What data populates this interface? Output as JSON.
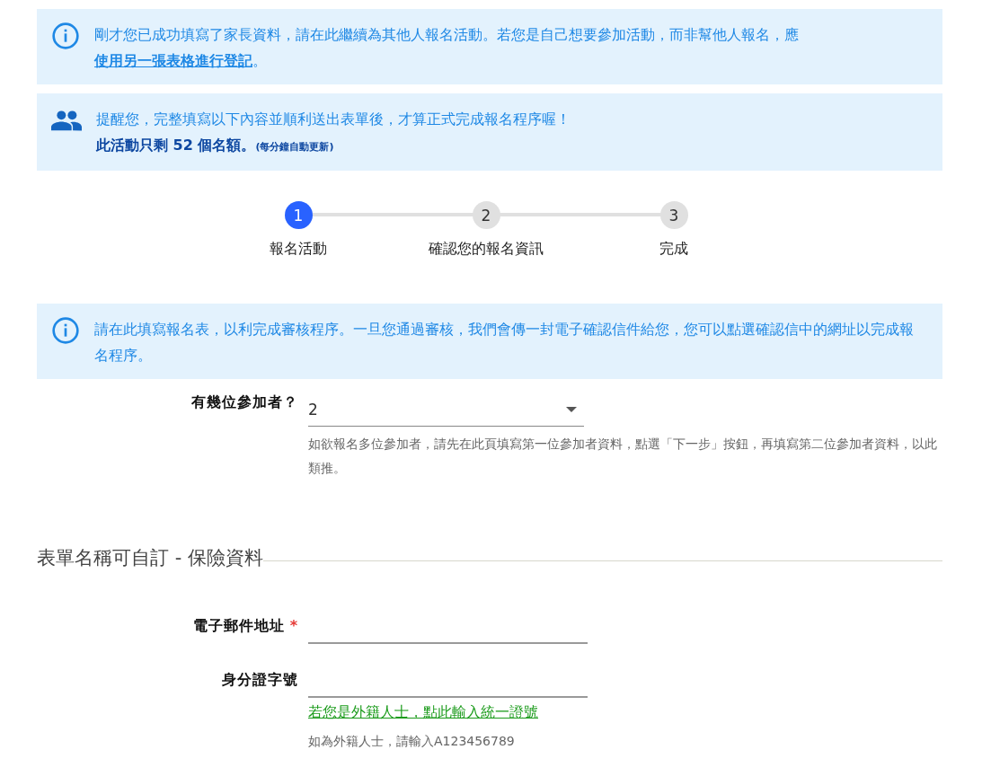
{
  "notices": [
    {
      "kind": "info",
      "before": "剛才您已成功填寫了家長資料，請在此繼續為其他人報名活動。若您是自己想要參加活動，而非幫他人報名，應",
      "link": "使用另一張表格進行登記",
      "after": "。"
    },
    {
      "kind": "people",
      "line": "提醒您，完整填寫以下內容並順利送出表單後，才算正式完成報名程序喔！",
      "quota": "此活動只剩 52 個名額。",
      "quota_note": "(每分鐘自動更新)"
    }
  ],
  "steps": [
    {
      "number": "1",
      "label": "報名活動",
      "selected": true
    },
    {
      "number": "2",
      "label": "確認您的報名資訊",
      "selected": false
    },
    {
      "number": "3",
      "label": "完成",
      "selected": false
    }
  ],
  "form_notice": {
    "kind": "info",
    "text": "請在此填寫報名表，以利完成審核程序。一旦您通過審核，我們會傳一封電子確認信件給您，您可以點選確認信中的網址以完成報名程序。"
  },
  "participants": {
    "label": "有幾位參加者？",
    "value": "2",
    "help": "如欲報名多位參加者，請先在此頁填寫第一位參加者資料，點選「下一步」按鈕，再填寫第二位參加者資料，以此類推。"
  },
  "section_title": "表單名稱可自訂 - 保險資料",
  "fields": [
    {
      "label": "電子郵件地址",
      "required_mark": "*"
    },
    {
      "label": "身分證字號",
      "link": "若您是外籍人士，點此輸入統一證號",
      "help": "如為外籍人士，請輸入A123456789"
    }
  ]
}
